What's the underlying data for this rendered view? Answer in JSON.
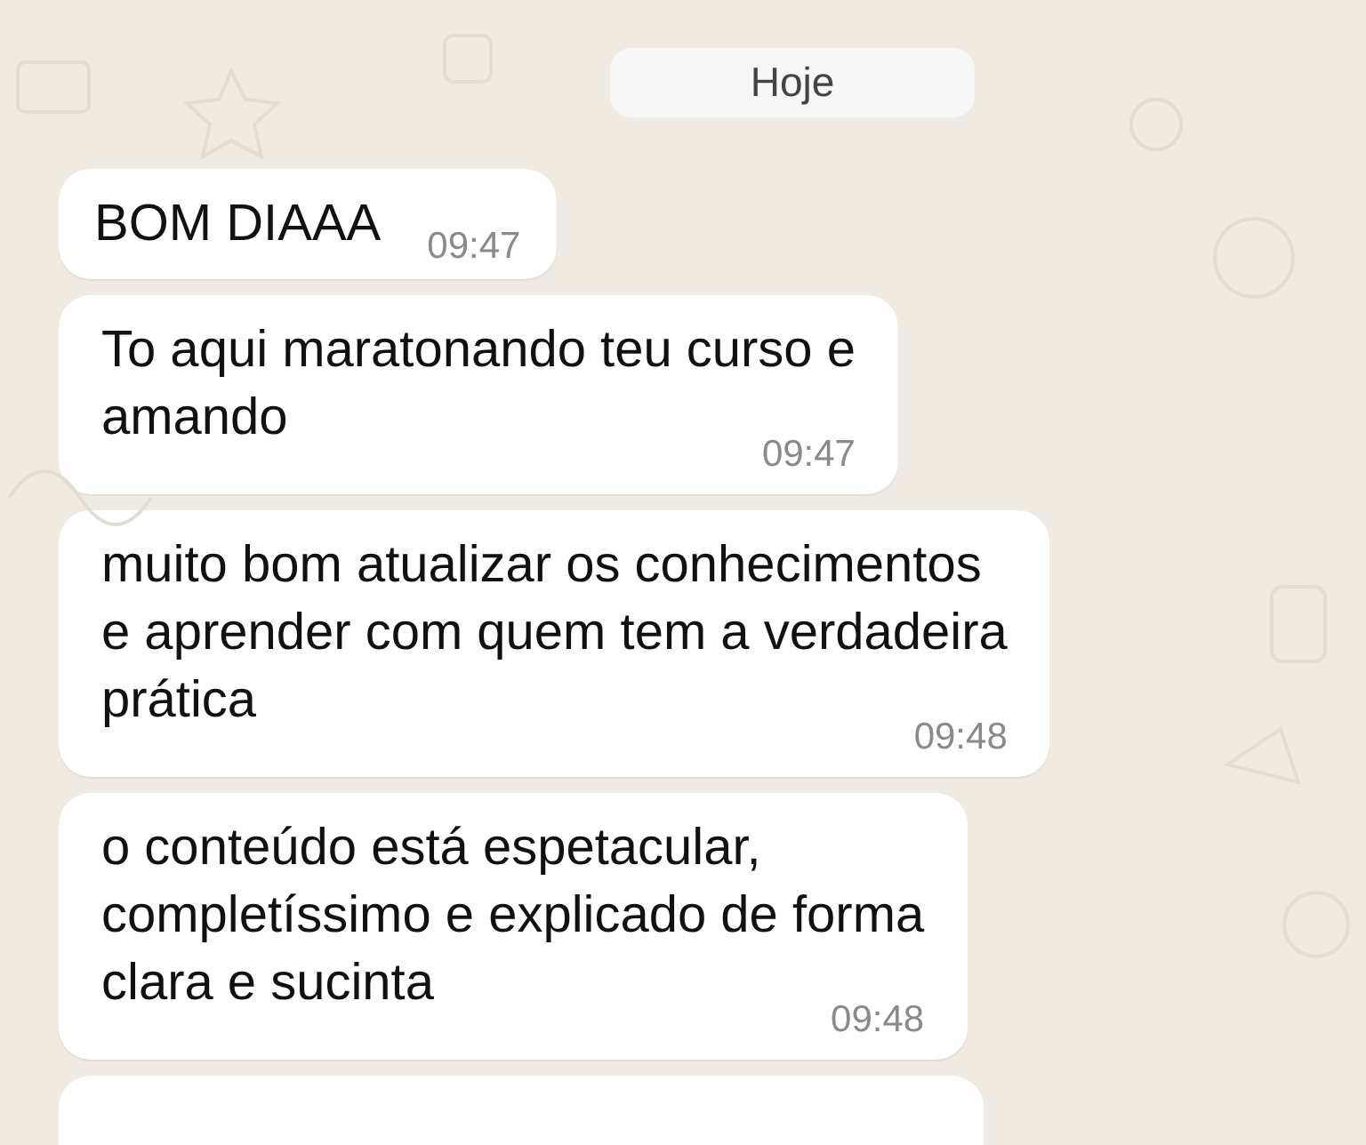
{
  "date_chip": "Hoje",
  "messages": [
    {
      "kind": "inline",
      "lines": [
        "BOM DIAAA"
      ],
      "time": "09:47"
    },
    {
      "kind": "block",
      "lines": [
        "To aqui maratonando teu curso e",
        "amando"
      ],
      "time": "09:47"
    },
    {
      "kind": "block",
      "lines": [
        "muito bom atualizar os conhecimentos",
        "e aprender com quem tem a verdadeira",
        "prática"
      ],
      "time": "09:48"
    },
    {
      "kind": "block",
      "lines": [
        "o conteúdo está espetacular,",
        "completíssimo e explicado de forma",
        "clara e sucinta"
      ],
      "time": "09:48"
    },
    {
      "kind": "cut"
    }
  ]
}
